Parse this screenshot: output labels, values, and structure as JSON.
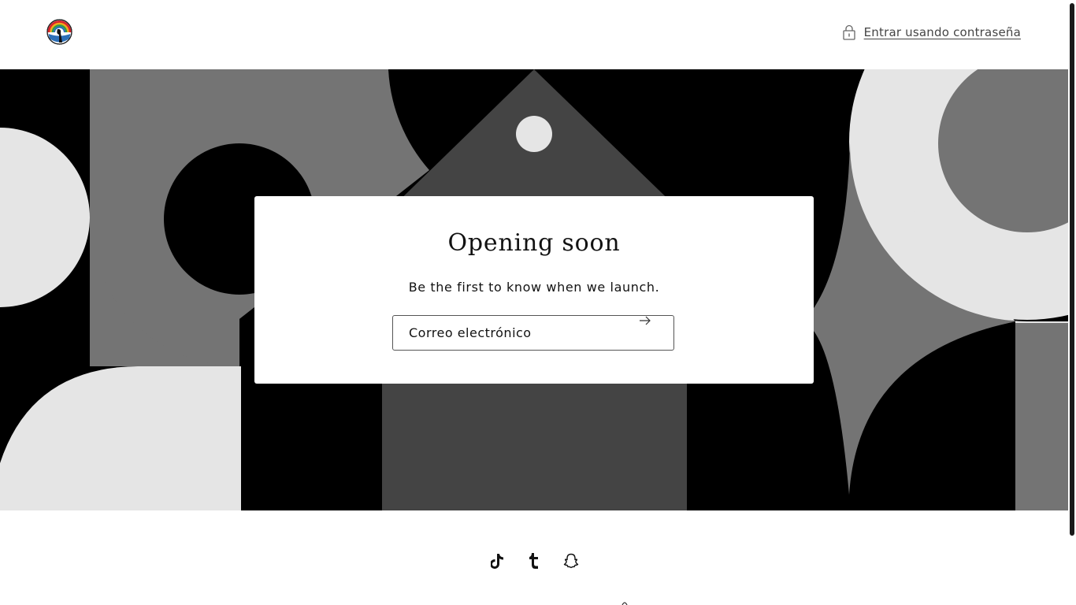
{
  "header": {
    "logo_icon": "store-logo-icon",
    "login_icon": "lock-icon",
    "login_label": "Entrar usando contraseña"
  },
  "hero": {
    "palette": {
      "black": "#000000",
      "dark_gray": "#444444",
      "mid_gray": "#747474",
      "light_gray": "#e5e5e5"
    }
  },
  "newsletter": {
    "title": "Opening soon",
    "subtitle": "Be the first to know when we launch.",
    "email_placeholder": "Correo electrónico",
    "submit_icon": "arrow-right-icon"
  },
  "social": [
    {
      "icon": "tiktok-icon"
    },
    {
      "icon": "tumblr-icon"
    },
    {
      "icon": "snapchat-icon"
    }
  ]
}
